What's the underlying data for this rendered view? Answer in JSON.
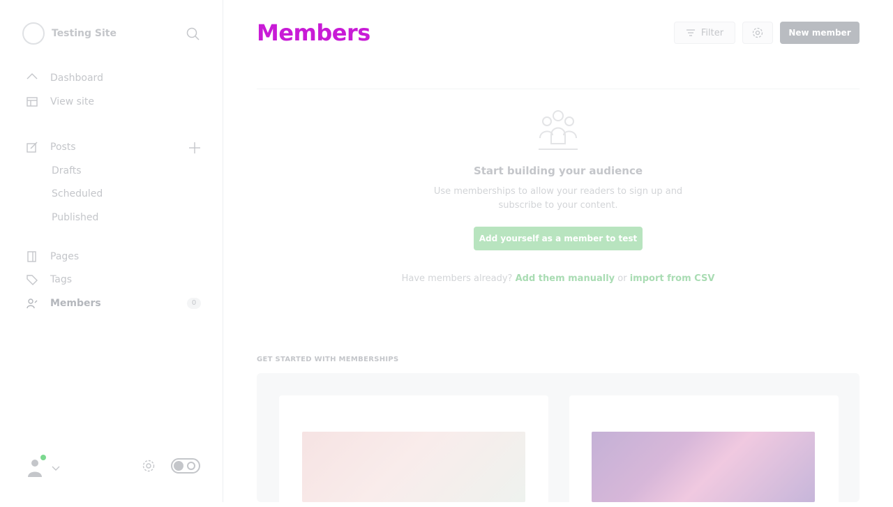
{
  "site": {
    "name": "Testing Site"
  },
  "sidebar": {
    "items": [
      {
        "label": "Dashboard"
      },
      {
        "label": "View site"
      },
      {
        "label": "Posts"
      },
      {
        "label": "Drafts"
      },
      {
        "label": "Scheduled"
      },
      {
        "label": "Published"
      },
      {
        "label": "Pages"
      },
      {
        "label": "Tags"
      },
      {
        "label": "Members",
        "count": "0"
      }
    ]
  },
  "header": {
    "title": "Members",
    "filter_label": "Filter",
    "new_member_label": "New member"
  },
  "empty_state": {
    "title": "Start building your audience",
    "description": "Use memberships to allow your readers to sign up and subscribe to your content.",
    "cta_label": "Add yourself as a member to test",
    "prompt": "Have members already?",
    "add_manually": "Add them manually",
    "or": "or",
    "import_csv": "import from CSV"
  },
  "get_started": {
    "label": "GET STARTED WITH MEMBERSHIPS"
  },
  "colors": {
    "accent": "#c81bd6",
    "green": "#30cf43"
  },
  "icons": [
    "search-icon",
    "home-icon",
    "view-site-icon",
    "posts-icon",
    "plus-icon",
    "pages-icon",
    "tags-icon",
    "members-icon",
    "user-avatar-icon",
    "chevron-down-icon",
    "gear-icon",
    "theme-toggle-icon",
    "filter-icon",
    "members-group-icon"
  ]
}
